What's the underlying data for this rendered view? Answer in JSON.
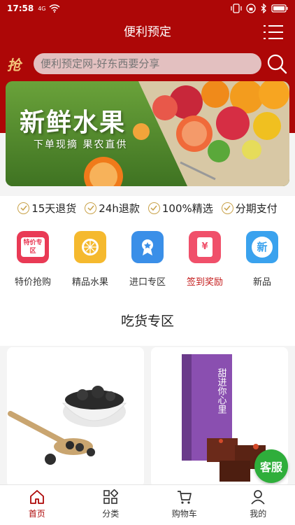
{
  "status_bar": {
    "time": "17:58",
    "network": "4G"
  },
  "header": {
    "title": "便利预定"
  },
  "search": {
    "brand_glyph": "抢",
    "placeholder": "便利预定网-好东西要分享"
  },
  "banner": {
    "title": "新鲜水果",
    "subtitle": "下单现摘 果农直供"
  },
  "guarantees": [
    "15天退货",
    "24h退款",
    "100%精选",
    "分期支付"
  ],
  "categories": [
    {
      "label": "特价抢购",
      "icon": "sale-tag-icon",
      "icon_text": "特价专区",
      "color": "#e93a55"
    },
    {
      "label": "精品水果",
      "icon": "orange-icon",
      "color": "#f5b92e"
    },
    {
      "label": "进口专区",
      "icon": "award-badge-icon",
      "color": "#3a8fe8"
    },
    {
      "label": "签到奖励",
      "icon": "red-envelope-icon",
      "icon_text": "¥",
      "color": "#f0506a",
      "highlight": "#c41b1b"
    },
    {
      "label": "新品",
      "icon": "new-badge-icon",
      "icon_text": "新",
      "color": "#3aa2ee"
    }
  ],
  "section": {
    "title": "吃货专区"
  },
  "products": [
    {
      "image": "black-fungus-image"
    },
    {
      "image": "brown-sugar-gift-box-image",
      "box_text": "甜进你心里"
    }
  ],
  "floating": {
    "service_label": "客服"
  },
  "tabbar": [
    {
      "label": "首页",
      "icon": "home-icon",
      "active": true
    },
    {
      "label": "分类",
      "icon": "category-grid-icon",
      "active": false
    },
    {
      "label": "购物车",
      "icon": "cart-icon",
      "active": false
    },
    {
      "label": "我的",
      "icon": "user-icon",
      "active": false
    }
  ],
  "colors": {
    "brand": "#ad0707",
    "accent_gold": "#c9a24a"
  }
}
